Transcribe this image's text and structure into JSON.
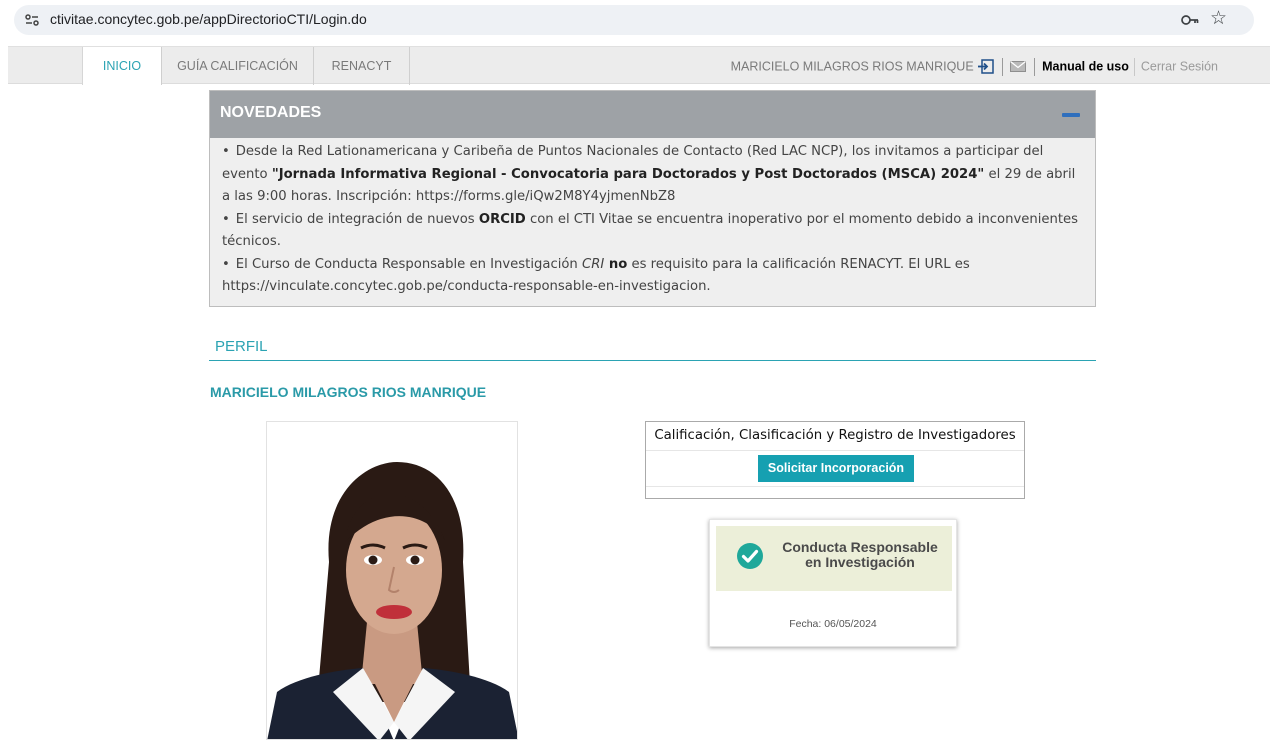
{
  "browser": {
    "url": "ctivitae.concytec.gob.pe/appDirectorioCTI/Login.do",
    "site_icon": "tune-icon",
    "key_icon": "password-key-icon",
    "star_icon": "bookmark-star-icon",
    "star_glyph": "☆"
  },
  "nav": {
    "tabs": [
      {
        "label": "INICIO",
        "active": true
      },
      {
        "label": "GUÍA CALIFICACIÓN",
        "active": false
      },
      {
        "label": "RENACYT",
        "active": false
      }
    ],
    "user_name": "MARICIELO MILAGROS RIOS MANRIQUE",
    "login_icon": "sign-in-icon",
    "mail_icon": "envelope-icon",
    "manual": "Manual de uso",
    "logout": "Cerrar Sesión",
    "accent_color": "#2ba3b3"
  },
  "novedades": {
    "title": "NOVEDADES",
    "toggle_icon": "minus-icon",
    "items": [
      {
        "pre": "Desde la Red Lationamericana y Caribeña de Puntos Nacionales de Contacto (Red LAC NCP), los invitamos a participar del evento ",
        "bold": "\"Jornada Informativa Regional - Convocatoria para Doctorados y Post Doctorados (MSCA) 2024\"",
        "post": " el 29 de abril a las 9:00 horas. Inscripción: https://forms.gle/iQw2M8Y4yjmenNbZ8"
      },
      {
        "pre": "El servicio de integración de nuevos ",
        "bold": "ORCID",
        "post": " con el CTI Vitae se encuentra inoperativo por el momento debido a inconvenientes técnicos."
      },
      {
        "pre": "El Curso de Conducta Responsable en Investigación ",
        "italic": "CRI",
        "bold": " no",
        "post": " es requisito para la calificación RENACYT. El URL es https://vinculate.concytec.gob.pe/conducta-responsable-en-investigacion."
      }
    ]
  },
  "perfil": {
    "title": "PERFIL",
    "name": "MARICIELO MILAGROS RIOS MANRIQUE"
  },
  "calificacion": {
    "title": "Calificación, Clasificación y Registro de Investigadores",
    "button": "Solicitar Incorporación",
    "button_color": "#16a0b1"
  },
  "badge": {
    "icon": "check-circle-icon",
    "line1": "Conducta Responsable",
    "line2": "en Investigación",
    "date": "Fecha: 06/05/2024"
  }
}
